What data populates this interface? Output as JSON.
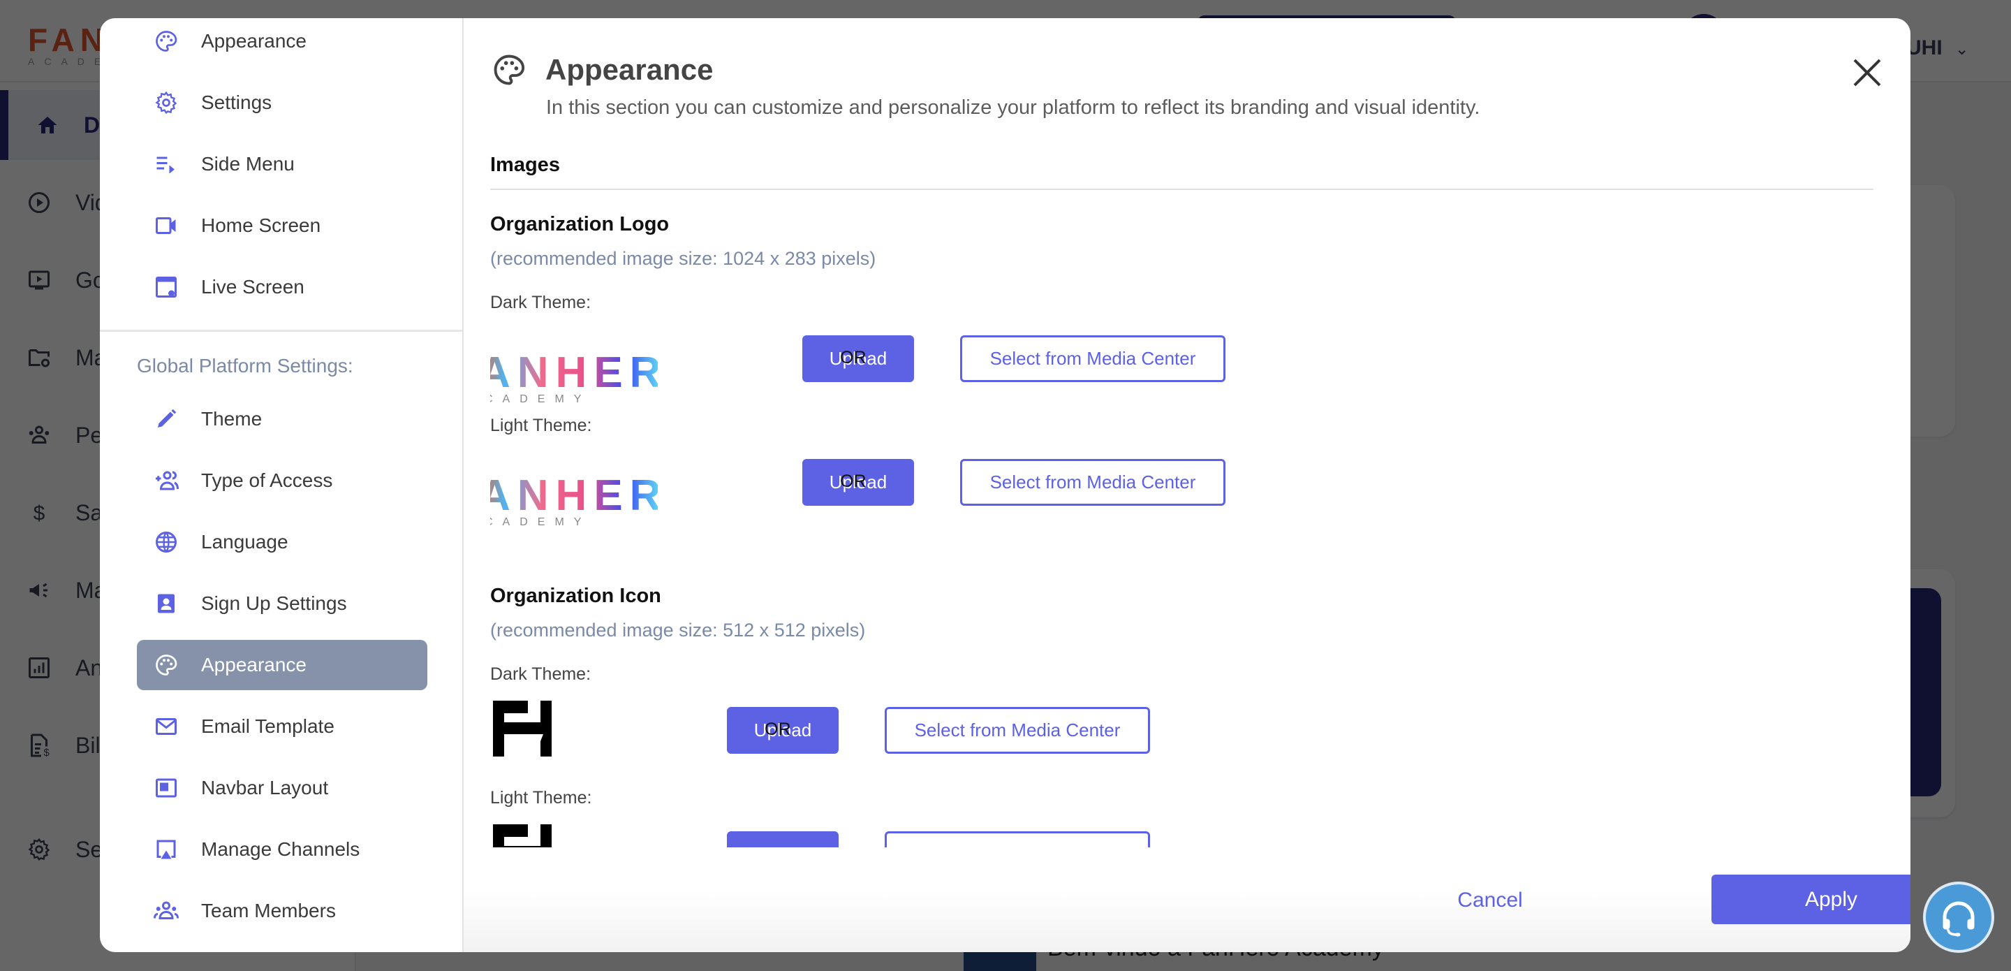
{
  "background": {
    "brand_name": "FANH",
    "brand_sub": "ACADEMY",
    "user_label": "UHI",
    "nav": [
      {
        "label": "D",
        "icon": "home-icon",
        "active": true
      },
      {
        "label": "Vid",
        "icon": "play-circle-icon"
      },
      {
        "label": "Go",
        "icon": "live-tv-icon"
      },
      {
        "label": "Ma",
        "icon": "folder-settings-icon"
      },
      {
        "label": "Peo",
        "icon": "people-icon"
      },
      {
        "label": "Sal",
        "icon": "dollar-icon"
      },
      {
        "label": "Ma",
        "icon": "megaphone-icon"
      },
      {
        "label": "An",
        "icon": "analytics-icon"
      },
      {
        "label": "Bil",
        "icon": "billing-icon"
      },
      {
        "label": "Se",
        "icon": "gear-icon"
      }
    ],
    "video_title": "Bem-vindo à FanHero Academy"
  },
  "modal": {
    "sidebar": {
      "top_items": [
        {
          "label": "Appearance",
          "icon": "palette-icon"
        },
        {
          "label": "Settings",
          "icon": "gear-icon"
        },
        {
          "label": "Side Menu",
          "icon": "playlist-icon"
        },
        {
          "label": "Home Screen",
          "icon": "video-camera-icon"
        },
        {
          "label": "Live Screen",
          "icon": "window-settings-icon"
        }
      ],
      "group_title": "Global Platform Settings:",
      "group_items": [
        {
          "label": "Theme",
          "icon": "pencil-icon"
        },
        {
          "label": "Type of Access",
          "icon": "group-add-icon"
        },
        {
          "label": "Language",
          "icon": "globe-icon"
        },
        {
          "label": "Sign Up Settings",
          "icon": "contact-card-icon"
        },
        {
          "label": "Appearance",
          "icon": "palette-icon",
          "selected": true
        },
        {
          "label": "Email Template",
          "icon": "mail-icon"
        },
        {
          "label": "Navbar Layout",
          "icon": "navbar-layout-icon"
        },
        {
          "label": "Manage Channels",
          "icon": "airplay-icon"
        },
        {
          "label": "Team Members",
          "icon": "team-icon"
        }
      ]
    },
    "header": {
      "title": "Appearance",
      "subtitle": "In this section you can customize and personalize your platform to reflect its branding and visual identity."
    },
    "images_heading": "Images",
    "org_logo": {
      "title": "Organization Logo",
      "hint": "(recommended image size: 1024 x 283 pixels)",
      "preview_word": "ANHERO",
      "preview_sub": "CADEMY",
      "rows": [
        {
          "label": "Dark Theme:"
        },
        {
          "label": "Light Theme:"
        }
      ]
    },
    "org_icon": {
      "title": "Organization Icon",
      "hint": "(recommended image size: 512 x 512 pixels)",
      "rows": [
        {
          "label": "Dark Theme:"
        },
        {
          "label": "Light Theme:"
        }
      ]
    },
    "upload_label": "Upload",
    "or_label": "OR",
    "media_label": "Select from Media Center",
    "footer": {
      "cancel_label": "Cancel",
      "apply_label": "Apply"
    }
  },
  "colors": {
    "accent": "#5d61e4",
    "selected_item": "#8592aa",
    "hint_text": "#7a8aa6",
    "overlay": "rgba(0,0,0,0.6)",
    "support_bubble": "#4a9ad8"
  }
}
